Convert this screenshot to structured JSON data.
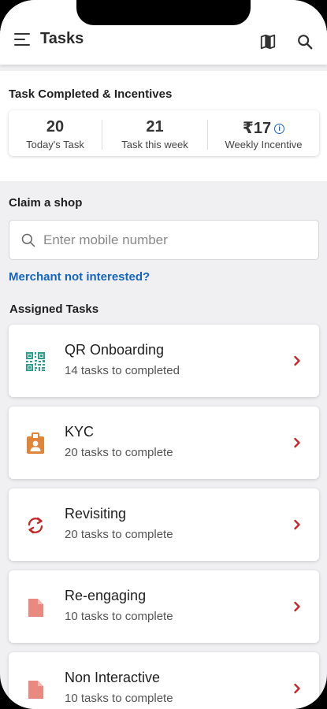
{
  "header": {
    "title": "Tasks",
    "icons": [
      "menu-icon",
      "map-icon",
      "search-icon"
    ]
  },
  "stats": {
    "heading": "Task Completed & Incentives",
    "items": [
      {
        "value": "20",
        "label": "Today's Task"
      },
      {
        "value": "21",
        "label": "Task this week"
      },
      {
        "value": "₹17",
        "label": "Weekly Incentive"
      }
    ],
    "info_symbol": "i"
  },
  "claim": {
    "heading": "Claim a shop",
    "placeholder": "Enter mobile number",
    "merchant_link": "Merchant not interested?"
  },
  "assigned": {
    "heading": "Assigned Tasks",
    "tasks": [
      {
        "title": "QR Onboarding",
        "subtitle": "14 tasks to completed",
        "icon": "qr-code-icon",
        "color": "#2e9e8f"
      },
      {
        "title": "KYC",
        "subtitle": "20 tasks to complete",
        "icon": "id-badge-icon",
        "color": "#e0843a"
      },
      {
        "title": "Revisiting",
        "subtitle": "20 tasks to complete",
        "icon": "refresh-icon",
        "color": "#c62828"
      },
      {
        "title": "Re-engaging",
        "subtitle": "10 tasks to complete",
        "icon": "document-icon",
        "color": "#e88a80"
      },
      {
        "title": "Non Interactive",
        "subtitle": "10 tasks to complete",
        "icon": "document-icon",
        "color": "#e88a80"
      }
    ]
  },
  "colors": {
    "accent_link": "#1565c0",
    "chevron": "#c62828",
    "background": "#f0f0f2"
  }
}
